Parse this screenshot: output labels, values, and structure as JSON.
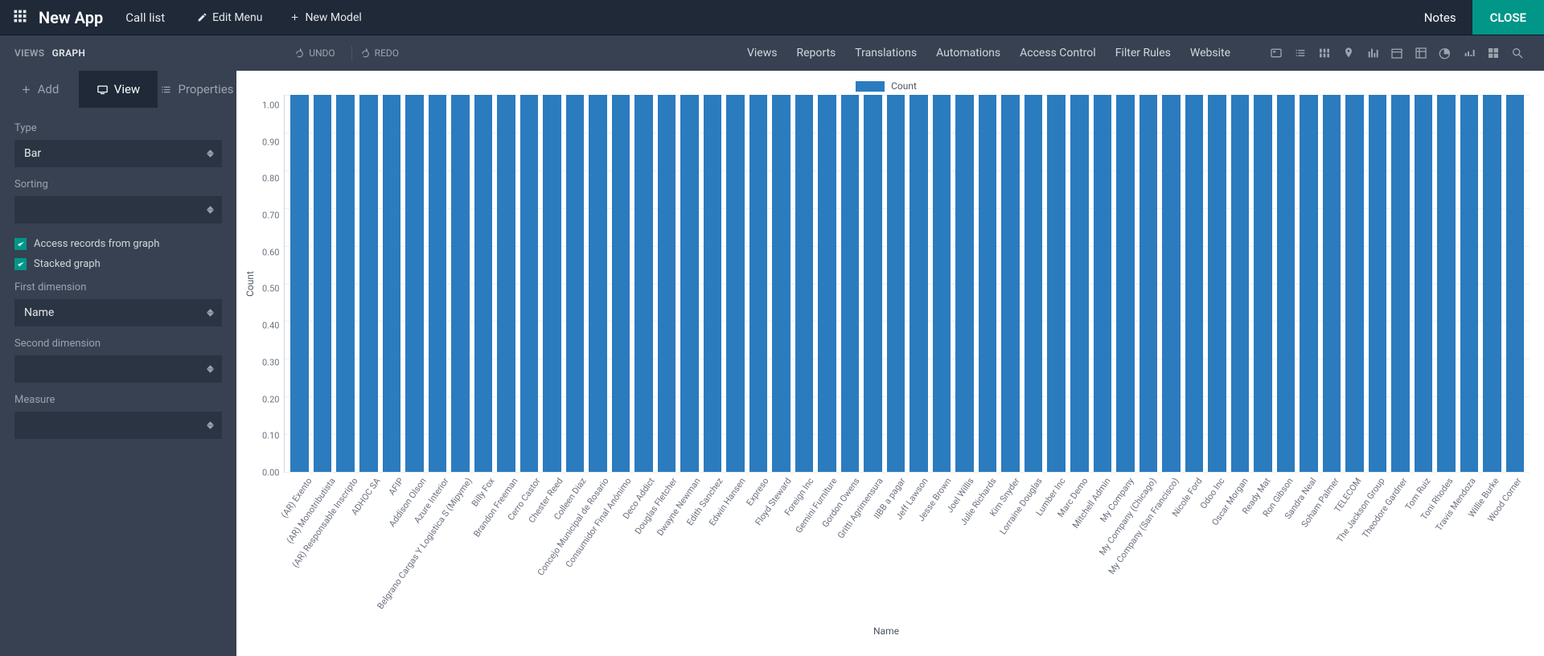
{
  "topbar": {
    "app_title": "New App",
    "page_title": "Call list",
    "edit_menu": "Edit Menu",
    "new_model": "New Model",
    "notes": "Notes",
    "close": "CLOSE"
  },
  "secondbar": {
    "crumb_views": "VIEWS",
    "crumb_graph": "GRAPH",
    "undo": "UNDO",
    "redo": "REDO",
    "menu": [
      "Views",
      "Reports",
      "Translations",
      "Automations",
      "Access Control",
      "Filter Rules",
      "Website"
    ]
  },
  "tabs": {
    "add": "Add",
    "view": "View",
    "properties": "Properties"
  },
  "form": {
    "type_label": "Type",
    "type_value": "Bar",
    "sorting_label": "Sorting",
    "sorting_value": "",
    "access_label": "Access records from graph",
    "stacked_label": "Stacked graph",
    "first_dim_label": "First dimension",
    "first_dim_value": "Name",
    "second_dim_label": "Second dimension",
    "second_dim_value": "",
    "measure_label": "Measure",
    "measure_value": ""
  },
  "chart_data": {
    "type": "bar",
    "title": "",
    "legend": "Count",
    "xlabel": "Name",
    "ylabel": "Count",
    "ylim": [
      0,
      1.0
    ],
    "yticks": [
      "1.00",
      "0.90",
      "0.80",
      "0.70",
      "0.60",
      "0.50",
      "0.40",
      "0.30",
      "0.20",
      "0.10",
      "0.00"
    ],
    "categories": [
      "(AR) Exento",
      "(AR) Monotributista",
      "(AR) Responsable Inscripto",
      "ADHOC SA",
      "AFIP",
      "Addison Olson",
      "Azure Interior",
      "Belgrano Cargas Y Logistica S (Mipyme)",
      "Billy Fox",
      "Brandon Freeman",
      "Cerro Castor",
      "Chester Reed",
      "Colleen Diaz",
      "Concejo Municipal de Rosario",
      "Consumidor Final Anónimo",
      "Deco Addict",
      "Douglas Fletcher",
      "Dwayne Newman",
      "Edith Sanchez",
      "Edwin Hansen",
      "Expreso",
      "Floyd Steward",
      "Foreign Inc",
      "Gemini Furniture",
      "Gordon Owens",
      "Gritti Agrimensura",
      "IIBB a pagar",
      "Jeff Lawson",
      "Jesse Brown",
      "Joel Willis",
      "Julie Richards",
      "Kim Snyder",
      "Lorraine Douglas",
      "Lumber Inc",
      "Marc Demo",
      "Mitchell Admin",
      "My Company",
      "My Company (Chicago)",
      "My Company (San Francisco)",
      "Nicole Ford",
      "Odoo Inc",
      "Oscar Morgan",
      "Ready Mat",
      "Ron Gibson",
      "Sandra Neal",
      "Soham Palmer",
      "TELECOM",
      "The Jackson Group",
      "Theodore Gardner",
      "Tom Ruiz",
      "Toni Rhodes",
      "Travis Mendoza",
      "Willie Burke",
      "Wood Corner"
    ],
    "values": [
      1,
      1,
      1,
      1,
      1,
      1,
      1,
      1,
      1,
      1,
      1,
      1,
      1,
      1,
      1,
      1,
      1,
      1,
      1,
      1,
      1,
      1,
      1,
      1,
      1,
      1,
      1,
      1,
      1,
      1,
      1,
      1,
      1,
      1,
      1,
      1,
      1,
      1,
      1,
      1,
      1,
      1,
      1,
      1,
      1,
      1,
      1,
      1,
      1,
      1,
      1,
      1,
      1,
      1
    ]
  },
  "colors": {
    "accent": "#009688",
    "bar": "#2b7bbf"
  }
}
